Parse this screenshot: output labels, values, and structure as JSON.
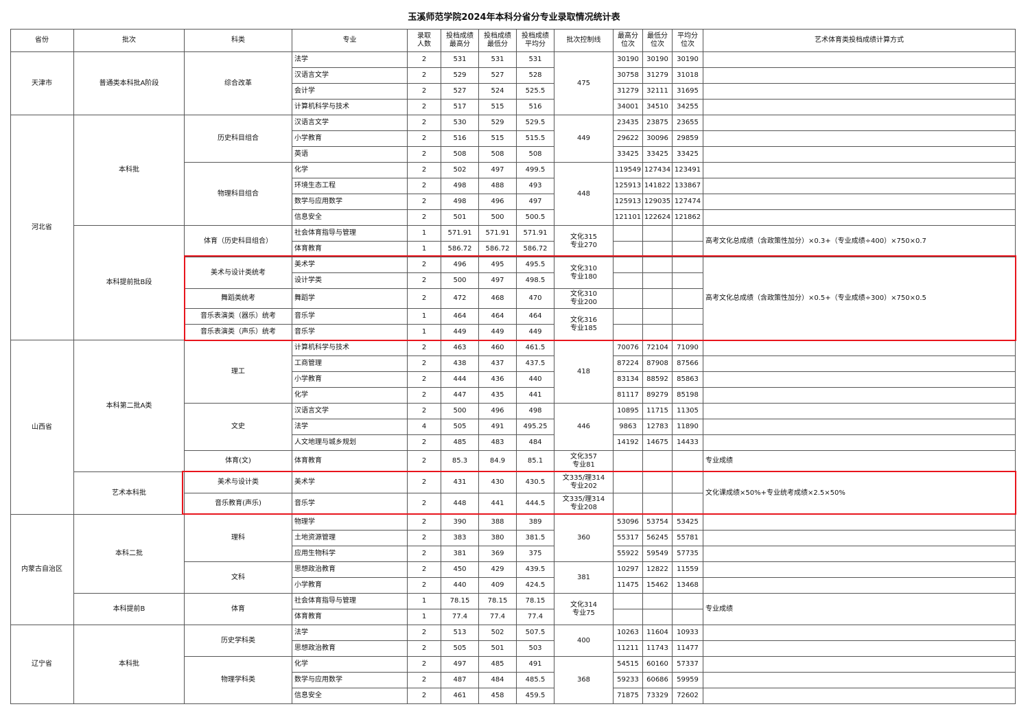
{
  "title": "玉溪师范学院2024年本科分省分专业录取情况统计表",
  "headers": [
    "省份",
    "批次",
    "科类",
    "专业",
    "录取\n人数",
    "投档成绩\n最高分",
    "投档成绩\n最低分",
    "投档成绩\n平均分",
    "批次控制线",
    "最高分\n位次",
    "最低分\n位次",
    "平均分\n位次",
    "艺术体育类投档成绩计算方式"
  ],
  "provinces": [
    "天津市",
    "河北省",
    "山西省",
    "内蒙古自治区",
    "辽宁省"
  ],
  "batches": [
    "普通类本科批A阶段",
    "本科批",
    "本科提前批B段",
    "本科第二批A类",
    "艺术本科批",
    "本科二批",
    "本科提前B",
    "本科批"
  ],
  "categories": [
    "综合改革",
    "历史科目组合",
    "物理科目组合",
    "体育（历史科目组合）",
    "美术与设计类统考",
    "舞蹈类统考",
    "音乐表演类（器乐）统考",
    "音乐表演类（声乐）统考",
    "理工",
    "文史",
    "体育(文)",
    "美术与设计类",
    "音乐教育(声乐)",
    "理科",
    "文科",
    "体育",
    "历史学科类",
    "物理学科类"
  ],
  "control_lines": [
    "475",
    "449",
    "448",
    "文化315\n专业270",
    "文化310\n专业180",
    "文化310\n专业200",
    "文化316\n专业185",
    "418",
    "446",
    "文化357\n专业81",
    "文335/理314\n专业202",
    "文335/理314\n专业208",
    "360",
    "381",
    "文化314\n专业75",
    "400",
    "368"
  ],
  "methods": [
    "高考文化总成绩（含政策性加分）×0.3+（专业成绩÷400）×750×0.7",
    "高考文化总成绩（含政策性加分）×0.5+（专业成绩÷300）×750×0.5",
    "专业成绩",
    "文化课成绩×50%+专业统考成绩×2.5×50%",
    "专业成绩"
  ],
  "rows": [
    {
      "major": "法学",
      "count": "2",
      "max": "531",
      "min": "531",
      "avg": "531",
      "rank_max": "30190",
      "rank_min": "30190",
      "rank_avg": "30190"
    },
    {
      "major": "汉语言文学",
      "count": "2",
      "max": "529",
      "min": "527",
      "avg": "528",
      "rank_max": "30758",
      "rank_min": "31279",
      "rank_avg": "31018"
    },
    {
      "major": "会计学",
      "count": "2",
      "max": "527",
      "min": "524",
      "avg": "525.5",
      "rank_max": "31279",
      "rank_min": "32111",
      "rank_avg": "31695"
    },
    {
      "major": "计算机科学与技术",
      "count": "2",
      "max": "517",
      "min": "515",
      "avg": "516",
      "rank_max": "34001",
      "rank_min": "34510",
      "rank_avg": "34255"
    },
    {
      "major": "汉语言文学",
      "count": "2",
      "max": "530",
      "min": "529",
      "avg": "529.5",
      "rank_max": "23435",
      "rank_min": "23875",
      "rank_avg": "23655"
    },
    {
      "major": "小学教育",
      "count": "2",
      "max": "516",
      "min": "515",
      "avg": "515.5",
      "rank_max": "29622",
      "rank_min": "30096",
      "rank_avg": "29859"
    },
    {
      "major": "英语",
      "count": "2",
      "max": "508",
      "min": "508",
      "avg": "508",
      "rank_max": "33425",
      "rank_min": "33425",
      "rank_avg": "33425"
    },
    {
      "major": "化学",
      "count": "2",
      "max": "502",
      "min": "497",
      "avg": "499.5",
      "rank_max": "119549",
      "rank_min": "127434",
      "rank_avg": "123491"
    },
    {
      "major": "环境生态工程",
      "count": "2",
      "max": "498",
      "min": "488",
      "avg": "493",
      "rank_max": "125913",
      "rank_min": "141822",
      "rank_avg": "133867"
    },
    {
      "major": "数学与应用数学",
      "count": "2",
      "max": "498",
      "min": "496",
      "avg": "497",
      "rank_max": "125913",
      "rank_min": "129035",
      "rank_avg": "127474"
    },
    {
      "major": "信息安全",
      "count": "2",
      "max": "501",
      "min": "500",
      "avg": "500.5",
      "rank_max": "121101",
      "rank_min": "122624",
      "rank_avg": "121862"
    },
    {
      "major": "社会体育指导与管理",
      "count": "1",
      "max": "571.91",
      "min": "571.91",
      "avg": "571.91",
      "rank_max": "",
      "rank_min": "",
      "rank_avg": ""
    },
    {
      "major": "体育教育",
      "count": "1",
      "max": "586.72",
      "min": "586.72",
      "avg": "586.72",
      "rank_max": "",
      "rank_min": "",
      "rank_avg": ""
    },
    {
      "major": "美术学",
      "count": "2",
      "max": "496",
      "min": "495",
      "avg": "495.5",
      "rank_max": "",
      "rank_min": "",
      "rank_avg": ""
    },
    {
      "major": "设计学类",
      "count": "2",
      "max": "500",
      "min": "497",
      "avg": "498.5",
      "rank_max": "",
      "rank_min": "",
      "rank_avg": ""
    },
    {
      "major": "舞蹈学",
      "count": "2",
      "max": "472",
      "min": "468",
      "avg": "470",
      "rank_max": "",
      "rank_min": "",
      "rank_avg": ""
    },
    {
      "major": "音乐学",
      "count": "1",
      "max": "464",
      "min": "464",
      "avg": "464",
      "rank_max": "",
      "rank_min": "",
      "rank_avg": ""
    },
    {
      "major": "音乐学",
      "count": "1",
      "max": "449",
      "min": "449",
      "avg": "449",
      "rank_max": "",
      "rank_min": "",
      "rank_avg": ""
    },
    {
      "major": "计算机科学与技术",
      "count": "2",
      "max": "463",
      "min": "460",
      "avg": "461.5",
      "rank_max": "70076",
      "rank_min": "72104",
      "rank_avg": "71090"
    },
    {
      "major": "工商管理",
      "count": "2",
      "max": "438",
      "min": "437",
      "avg": "437.5",
      "rank_max": "87224",
      "rank_min": "87908",
      "rank_avg": "87566"
    },
    {
      "major": "小学教育",
      "count": "2",
      "max": "444",
      "min": "436",
      "avg": "440",
      "rank_max": "83134",
      "rank_min": "88592",
      "rank_avg": "85863"
    },
    {
      "major": "化学",
      "count": "2",
      "max": "447",
      "min": "435",
      "avg": "441",
      "rank_max": "81117",
      "rank_min": "89279",
      "rank_avg": "85198"
    },
    {
      "major": "汉语言文学",
      "count": "2",
      "max": "500",
      "min": "496",
      "avg": "498",
      "rank_max": "10895",
      "rank_min": "11715",
      "rank_avg": "11305"
    },
    {
      "major": "法学",
      "count": "4",
      "max": "505",
      "min": "491",
      "avg": "495.25",
      "rank_max": "9863",
      "rank_min": "12783",
      "rank_avg": "11890"
    },
    {
      "major": "人文地理与城乡规划",
      "count": "2",
      "max": "485",
      "min": "483",
      "avg": "484",
      "rank_max": "14192",
      "rank_min": "14675",
      "rank_avg": "14433"
    },
    {
      "major": "体育教育",
      "count": "2",
      "max": "85.3",
      "min": "84.9",
      "avg": "85.1",
      "rank_max": "",
      "rank_min": "",
      "rank_avg": ""
    },
    {
      "major": "美术学",
      "count": "2",
      "max": "431",
      "min": "430",
      "avg": "430.5",
      "rank_max": "",
      "rank_min": "",
      "rank_avg": ""
    },
    {
      "major": "音乐学",
      "count": "2",
      "max": "448",
      "min": "441",
      "avg": "444.5",
      "rank_max": "",
      "rank_min": "",
      "rank_avg": ""
    },
    {
      "major": "物理学",
      "count": "2",
      "max": "390",
      "min": "388",
      "avg": "389",
      "rank_max": "53096",
      "rank_min": "53754",
      "rank_avg": "53425"
    },
    {
      "major": "土地资源管理",
      "count": "2",
      "max": "383",
      "min": "380",
      "avg": "381.5",
      "rank_max": "55317",
      "rank_min": "56245",
      "rank_avg": "55781"
    },
    {
      "major": "应用生物科学",
      "count": "2",
      "max": "381",
      "min": "369",
      "avg": "375",
      "rank_max": "55922",
      "rank_min": "59549",
      "rank_avg": "57735"
    },
    {
      "major": "思想政治教育",
      "count": "2",
      "max": "450",
      "min": "429",
      "avg": "439.5",
      "rank_max": "10297",
      "rank_min": "12822",
      "rank_avg": "11559"
    },
    {
      "major": "小学教育",
      "count": "2",
      "max": "440",
      "min": "409",
      "avg": "424.5",
      "rank_max": "11475",
      "rank_min": "15462",
      "rank_avg": "13468"
    },
    {
      "major": "社会体育指导与管理",
      "count": "1",
      "max": "78.15",
      "min": "78.15",
      "avg": "78.15",
      "rank_max": "",
      "rank_min": "",
      "rank_avg": ""
    },
    {
      "major": "体育教育",
      "count": "1",
      "max": "77.4",
      "min": "77.4",
      "avg": "77.4",
      "rank_max": "",
      "rank_min": "",
      "rank_avg": ""
    },
    {
      "major": "法学",
      "count": "2",
      "max": "513",
      "min": "502",
      "avg": "507.5",
      "rank_max": "10263",
      "rank_min": "11604",
      "rank_avg": "10933"
    },
    {
      "major": "思想政治教育",
      "count": "2",
      "max": "505",
      "min": "501",
      "avg": "503",
      "rank_max": "11211",
      "rank_min": "11743",
      "rank_avg": "11477"
    },
    {
      "major": "化学",
      "count": "2",
      "max": "497",
      "min": "485",
      "avg": "491",
      "rank_max": "54515",
      "rank_min": "60160",
      "rank_avg": "57337"
    },
    {
      "major": "数学与应用数学",
      "count": "2",
      "max": "487",
      "min": "484",
      "avg": "485.5",
      "rank_max": "59233",
      "rank_min": "60686",
      "rank_avg": "59959"
    },
    {
      "major": "信息安全",
      "count": "2",
      "max": "461",
      "min": "458",
      "avg": "459.5",
      "rank_max": "71875",
      "rank_min": "73329",
      "rank_avg": "72602"
    }
  ],
  "highlight_color": "#e8141c"
}
